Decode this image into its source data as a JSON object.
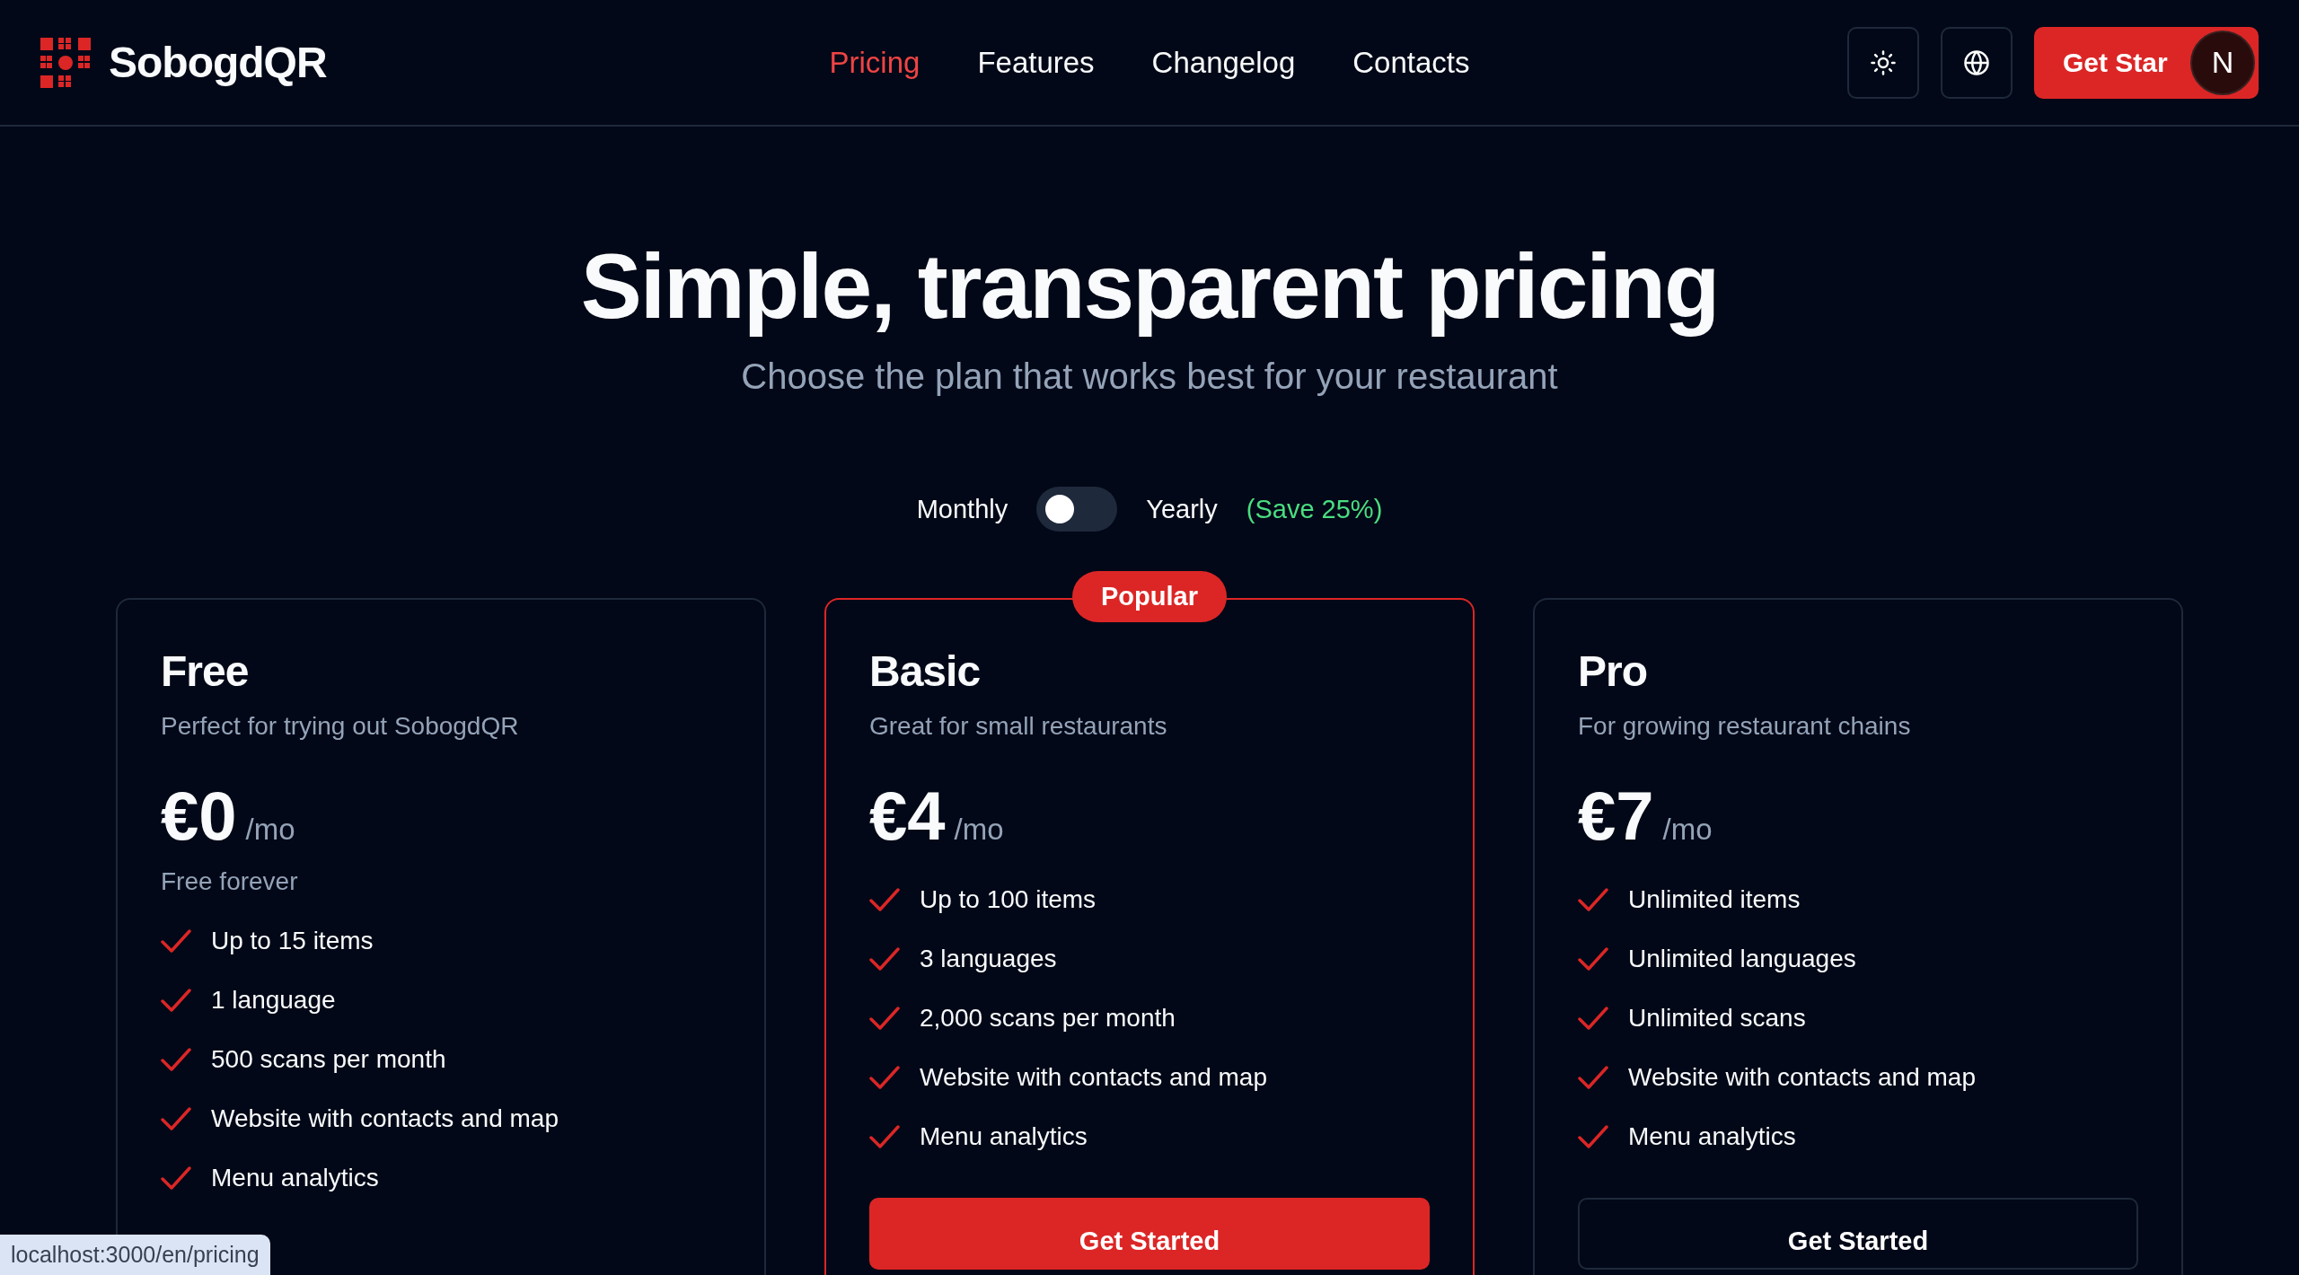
{
  "header": {
    "brand": "SobogdQR",
    "nav": [
      {
        "label": "Pricing",
        "selected": true
      },
      {
        "label": "Features",
        "selected": false
      },
      {
        "label": "Changelog",
        "selected": false
      },
      {
        "label": "Contacts",
        "selected": false
      }
    ],
    "cta": "Get Star",
    "dev_badge": "N"
  },
  "hero": {
    "title": "Simple, transparent pricing",
    "subtitle": "Choose the plan that works best for your restaurant"
  },
  "billing": {
    "monthly": "Monthly",
    "yearly": "Yearly",
    "save": "(Save 25%)",
    "yearly_on": false
  },
  "plans": [
    {
      "name": "Free",
      "description": "Perfect for trying out SobogdQR",
      "price": "€0",
      "period": "/mo",
      "note": "Free forever",
      "highlighted": false,
      "features": [
        "Up to 15 items",
        "1 language",
        "500 scans per month",
        "Website with contacts and map",
        "Menu analytics"
      ]
    },
    {
      "name": "Basic",
      "description": "Great for small restaurants",
      "price": "€4",
      "period": "/mo",
      "badge": "Popular",
      "highlighted": true,
      "button": "Get Started",
      "features": [
        "Up to 100 items",
        "3 languages",
        "2,000 scans per month",
        "Website with contacts and map",
        "Menu analytics"
      ]
    },
    {
      "name": "Pro",
      "description": "For growing restaurant chains",
      "price": "€7",
      "period": "/mo",
      "highlighted": false,
      "button": "Get Started",
      "features": [
        "Unlimited items",
        "Unlimited languages",
        "Unlimited scans",
        "Website with contacts and map",
        "Menu analytics"
      ]
    }
  ],
  "status_url": "localhost:3000/en/pricing"
}
